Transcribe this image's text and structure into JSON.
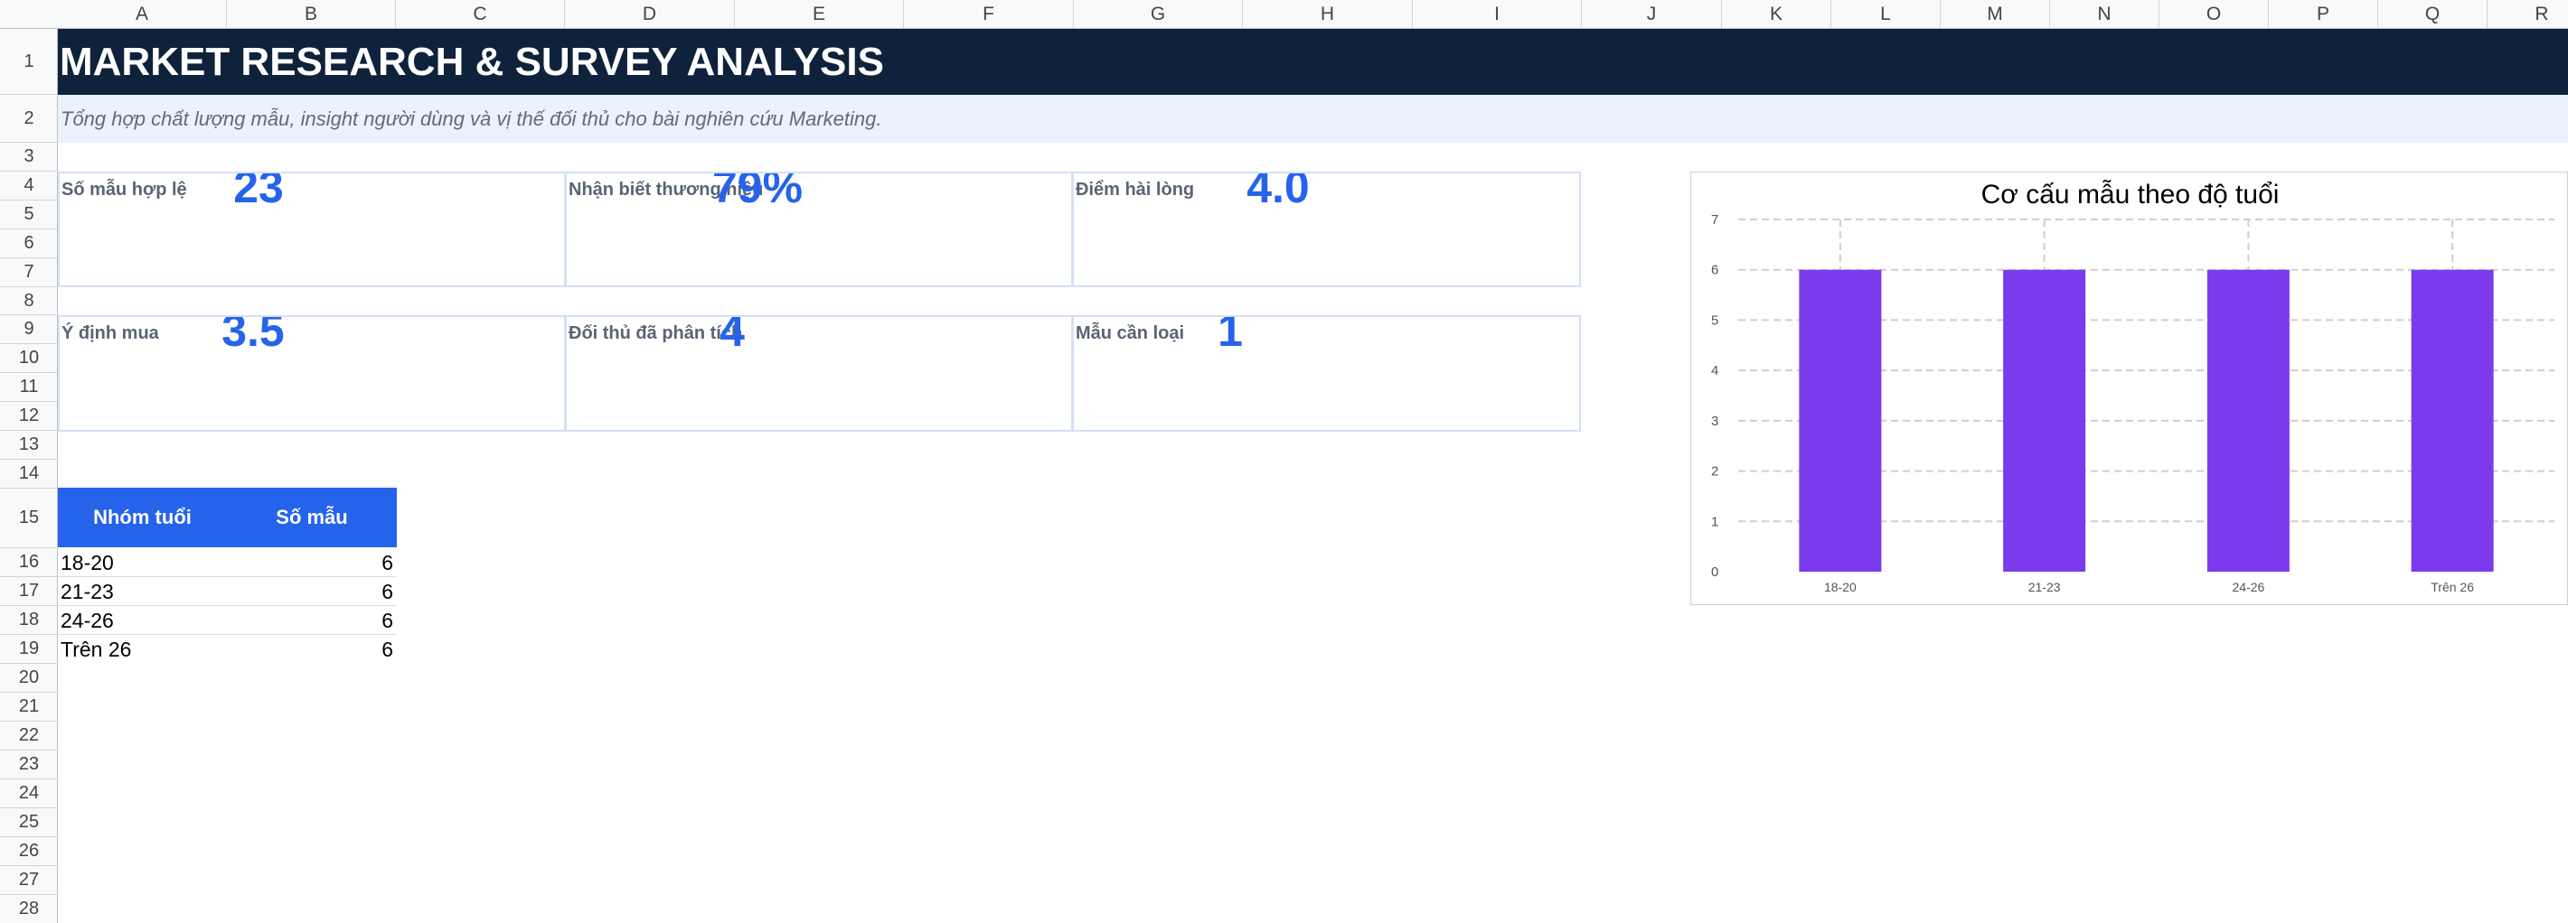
{
  "columns": [
    "A",
    "B",
    "C",
    "D",
    "E",
    "F",
    "G",
    "H",
    "I",
    "J",
    "K",
    "L",
    "M",
    "N",
    "O",
    "P",
    "Q",
    "R"
  ],
  "rows": [
    "1",
    "2",
    "3",
    "4",
    "5",
    "6",
    "7",
    "8",
    "9",
    "10",
    "11",
    "12",
    "13",
    "14",
    "15",
    "16",
    "17",
    "18",
    "19",
    "20",
    "21",
    "22",
    "23",
    "24",
    "25",
    "26",
    "27",
    "28"
  ],
  "title": "MARKET RESEARCH & SURVEY ANALYSIS",
  "subtitle": "Tổng hợp chất lượng mẫu, insight người dùng và vị thế đối thủ cho bài nghiên cứu Marketing.",
  "kpis": [
    {
      "label": "Số mẫu hợp lệ",
      "value": "23"
    },
    {
      "label": "Nhận biết thương hiệu",
      "value": "79%"
    },
    {
      "label": "Điểm hài lòng",
      "value": "4.0"
    },
    {
      "label": "Ý định mua",
      "value": "3.5"
    },
    {
      "label": "Đối thủ đã phân tích",
      "value": "4"
    },
    {
      "label": "Mẫu cần loại",
      "value": "1"
    }
  ],
  "table": {
    "headers": [
      "Nhóm tuổi",
      "Số mẫu"
    ],
    "rows": [
      [
        "18-20",
        "6"
      ],
      [
        "21-23",
        "6"
      ],
      [
        "24-26",
        "6"
      ],
      [
        "Trên 26",
        "6"
      ]
    ]
  },
  "colors": {
    "title_bg": "#0f223b",
    "subtitle_bg": "#ebf1fd",
    "accent": "#2563eb",
    "bar": "#7c3aed"
  },
  "chart_data": {
    "type": "bar",
    "title": "Cơ cấu mẫu theo độ tuổi",
    "categories": [
      "18-20",
      "21-23",
      "24-26",
      "Trên 26"
    ],
    "values": [
      6,
      6,
      6,
      6
    ],
    "ylim": [
      0,
      7
    ],
    "yticks": [
      0,
      1,
      2,
      3,
      4,
      5,
      6,
      7
    ],
    "grid": true,
    "legend": "none"
  }
}
